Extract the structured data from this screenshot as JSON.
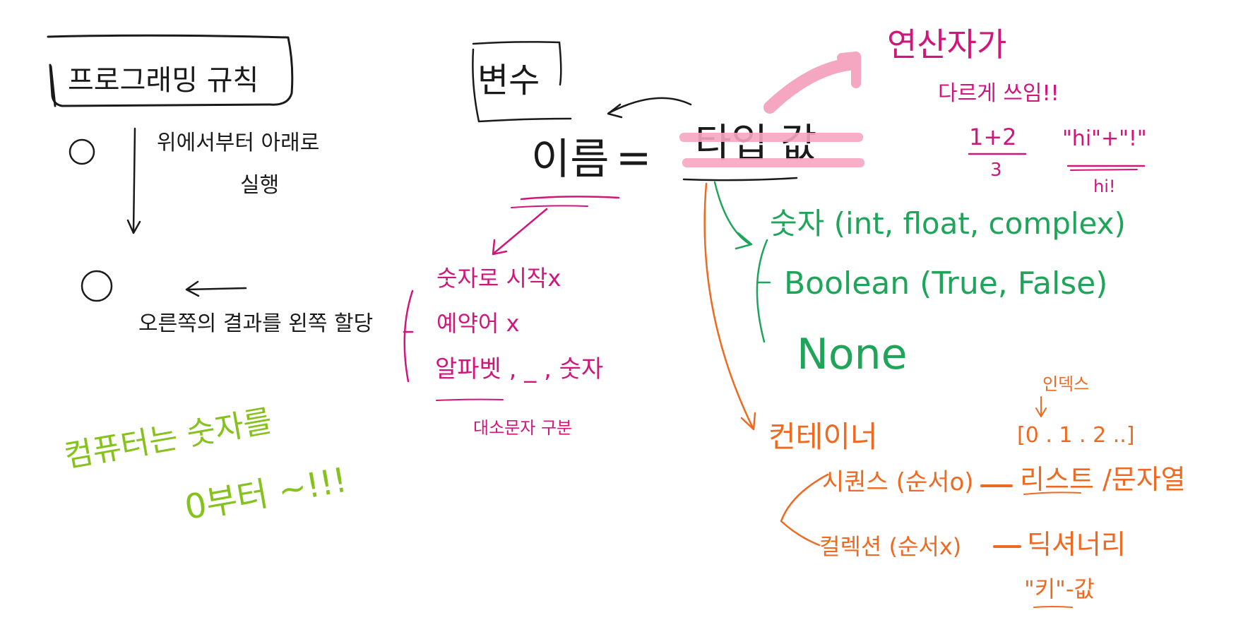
{
  "colors": {
    "ink": "#1a1a1a",
    "magenta": "#d0167a",
    "green": "#1fa55a",
    "orange": "#ee6a22",
    "lime": "#86c21c",
    "highlight": "#f5a6c0"
  },
  "rules": {
    "title": "프로그래밍 규칙",
    "step1_num": "①",
    "step1_line1": "위에서부터 아래로",
    "step1_line2": "실행",
    "step2_num": "②",
    "step2_text": "오른쪽의 결과를 왼쪽 할당"
  },
  "variable": {
    "label": "변수",
    "name": "이름",
    "equals": "=",
    "type_value": "타입 값"
  },
  "operator": {
    "line1": "연산자가",
    "line2": "다르게 쓰임!!",
    "ex1_expr": "1+2",
    "ex1_result": "3",
    "ex2_expr": "\"hi\"+\"!\"",
    "ex2_result": "hi!"
  },
  "naming": {
    "rule1": "숫자로 시작x",
    "rule2": "예약어 x",
    "rule3": "알파벳 , _ , 숫자",
    "note": "대소문자 구분"
  },
  "types": {
    "number": "숫자 (int, float, complex)",
    "boolean": "Boolean (True, False)",
    "none": "None"
  },
  "container": {
    "label": "컨테이너",
    "index_label": "인덱스",
    "index_values": "[0 . 1 . 2 ..]",
    "sequence": "시퀀스 (순서o)",
    "sequence_result": "리스트 /문자열",
    "collection": "컬렉션 (순서x)",
    "collection_result": "딕셔너리",
    "key_value": "\"키\"-값"
  },
  "note_zero": {
    "line1": "컴퓨터는 숫자를",
    "line2": "0부터 ~!!!"
  }
}
